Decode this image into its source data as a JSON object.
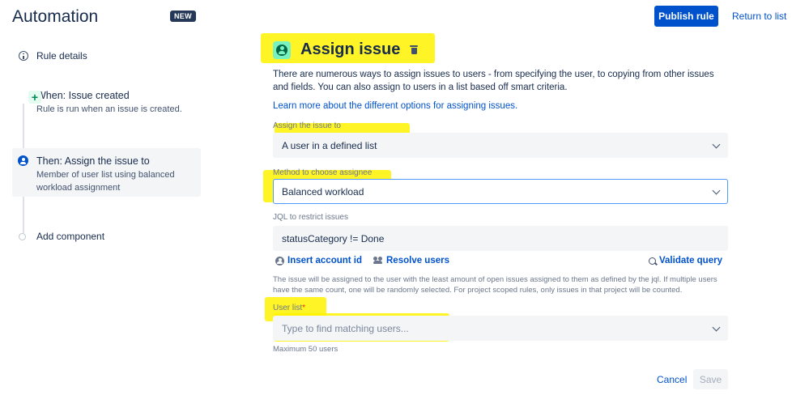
{
  "app": {
    "title": "Automation",
    "badge": "NEW"
  },
  "sidebar": {
    "rule_details": "Rule details",
    "when": {
      "title": "When: Issue created",
      "subtitle": "Rule is run when an issue is created."
    },
    "then": {
      "title": "Then: Assign the issue to",
      "subtitle": "Member of user list using balanced workload assignment"
    },
    "add_component": "Add component"
  },
  "header": {
    "publish_label": "Publish rule",
    "return_label": "Return to list"
  },
  "main": {
    "title": "Assign issue",
    "description": "There are numerous ways to assign issues to users - from specifying the user, to copying from other issues and fields. You can also assign to users in a list based off smart criteria.",
    "learn_more": "Learn more about the different options for assigning issues.",
    "assign_to": {
      "label": "Assign the issue to",
      "value": "A user in a defined list"
    },
    "method": {
      "label": "Method to choose assignee",
      "value": "Balanced workload"
    },
    "jql": {
      "label": "JQL to restrict issues",
      "value": "statusCategory != Done"
    },
    "actions": {
      "insert_account": "Insert account id",
      "resolve_users": "Resolve users",
      "validate_query": "Validate query"
    },
    "helper": "The issue will be assigned to the user with the least amount of open issues assigned to them as defined by the jql. If multiple users have the same count, one will be randomly selected. For project scoped rules, only issues in that project will be counted.",
    "user_list": {
      "label": "User list",
      "required_mark": "*",
      "placeholder": "Type to find matching users...",
      "hint": "Maximum 50 users"
    },
    "cancel_label": "Cancel",
    "save_label": "Save"
  },
  "colors": {
    "primary": "#0052cc",
    "highlight": "#fff200",
    "focus_border": "#4c9aff"
  }
}
